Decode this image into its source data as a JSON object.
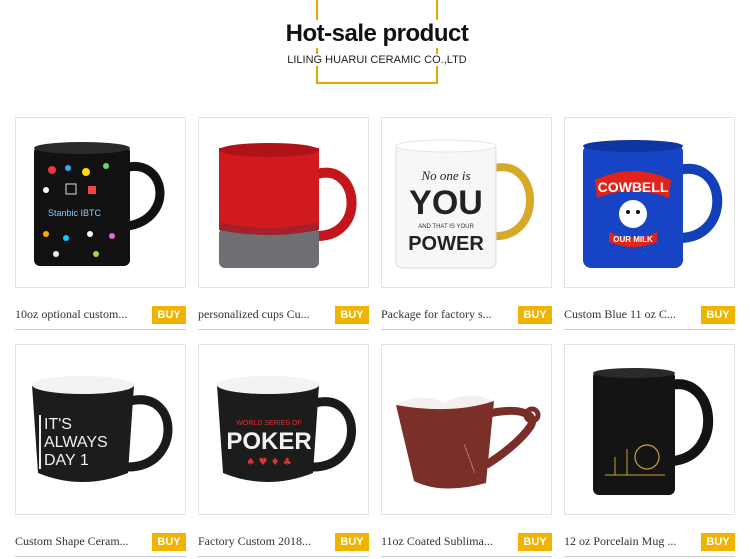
{
  "header": {
    "title": "Hot-sale product",
    "subtitle": "LILING HUARUI CERAMIC CO.,LTD"
  },
  "buy_label": "BUY",
  "products": [
    {
      "caption": "10oz optional custom..."
    },
    {
      "caption": "personalized cups Cu..."
    },
    {
      "caption": "Package for factory s..."
    },
    {
      "caption": "Custom Blue 11 oz C..."
    },
    {
      "caption": "Custom Shape Ceram..."
    },
    {
      "caption": "Factory Custom 2018..."
    },
    {
      "caption": "11oz Coated Sublima..."
    },
    {
      "caption": "12 oz Porcelain Mug ..."
    }
  ],
  "mug_prints": {
    "stanbic": "Stanbic IBTC",
    "noone1": "No one is",
    "noone2": "YOU",
    "noone3": "AND THAT IS YOUR",
    "noone4": "POWER",
    "cowbell": "COWBELL",
    "ourmilk": "OUR MILK",
    "its1": "IT'S",
    "its2": "ALWAYS",
    "its3": "DAY 1",
    "wsop": "WORLD SERIES OF",
    "poker": "POKER"
  },
  "colors": {
    "accent": "#f0b400",
    "frame": "#e0a800"
  }
}
